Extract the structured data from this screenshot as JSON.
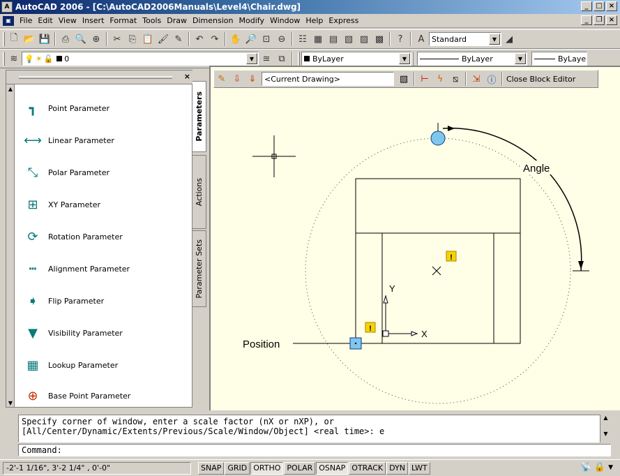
{
  "window": {
    "title": "AutoCAD 2006 - [C:\\AutoCAD2006Manuals\\Level4\\Chair.dwg]"
  },
  "menu": [
    "File",
    "Edit",
    "View",
    "Insert",
    "Format",
    "Tools",
    "Draw",
    "Dimension",
    "Modify",
    "Window",
    "Help",
    "Express"
  ],
  "toolbar": {
    "text_style": "Standard",
    "layer": "0",
    "color": "ByLayer",
    "linetype": "ByLayer",
    "lineweight": "ByLaye"
  },
  "palette": {
    "tabs": [
      "Parameters",
      "Actions",
      "Parameter Sets"
    ],
    "items": [
      "Point Parameter",
      "Linear Parameter",
      "Polar Parameter",
      "XY Parameter",
      "Rotation Parameter",
      "Alignment Parameter",
      "Flip Parameter",
      "Visibility Parameter",
      "Lookup Parameter",
      "Base Point Parameter"
    ]
  },
  "block_editor": {
    "drawing": "<Current Drawing>",
    "close_label": "Close Block Editor"
  },
  "drawing": {
    "angle_label": "Angle",
    "position_label": "Position",
    "ucs_x": "X",
    "ucs_y": "Y",
    "alert": "!"
  },
  "command": {
    "line1": "Specify corner of window, enter a scale factor (nX or nXP), or",
    "line2": "[All/Center/Dynamic/Extents/Previous/Scale/Window/Object] <real time>: e",
    "prompt": "Command:"
  },
  "status": {
    "coords": "-2'-1 1/16\",  3'-2 1/4\"  , 0'-0\"",
    "buttons": [
      "SNAP",
      "GRID",
      "ORTHO",
      "POLAR",
      "OSNAP",
      "OTRACK",
      "DYN",
      "LWT"
    ],
    "active": [
      "ORTHO",
      "OSNAP"
    ]
  }
}
